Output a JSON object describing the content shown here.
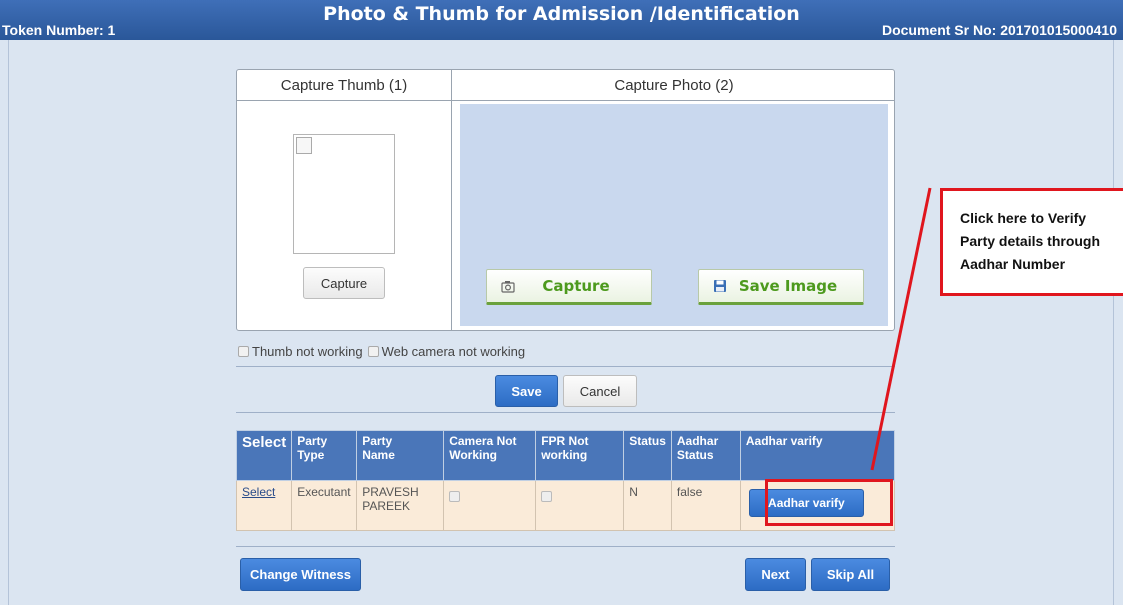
{
  "header": {
    "title": "Photo & Thumb for Admission /Identification",
    "token_label": "Token Number: 1",
    "document_label": "Document Sr No: 201701015000410"
  },
  "capture": {
    "thumb_title": "Capture Thumb (1)",
    "photo_title": "Capture Photo (2)",
    "thumb_capture_label": "Capture",
    "photo_capture_label": "Capture",
    "save_image_label": "Save Image"
  },
  "options": {
    "thumb_not_working": "Thumb not working",
    "web_camera_not_working": "Web camera not working"
  },
  "actions": {
    "save_label": "Save",
    "cancel_label": "Cancel",
    "change_witness_label": "Change Witness",
    "next_label": "Next",
    "skip_all_label": "Skip All"
  },
  "table": {
    "headers": {
      "select": "Select",
      "party_type_1": "Party",
      "party_type_2": "Type",
      "party_name_1": "Party",
      "party_name_2": "Name",
      "camera_1": "Camera Not",
      "camera_2": "Working",
      "fpr_1": "FPR Not",
      "fpr_2": "working",
      "status": "Status",
      "aadhar_status_1": "Aadhar",
      "aadhar_status_2": "Status",
      "aadhar_verify": "Aadhar varify"
    },
    "rows": [
      {
        "select": "Select",
        "party_type": "Executant",
        "party_name_1": "PRAVESH",
        "party_name_2": "PAREEK",
        "camera_not_working": false,
        "fpr_not_working": false,
        "status": "N",
        "aadhar_status": "false",
        "aadhar_verify_label": "Aadhar varify"
      }
    ]
  },
  "callout": {
    "line1": "Click here to Verify",
    "line2": "Party details through",
    "line3": "Aadhar Number"
  },
  "colors": {
    "header_bar": "#2f5fa6",
    "page_bg": "#dbe5f1",
    "button_blue": "#3574cc",
    "table_header": "#4a76b9",
    "table_row": "#faebd9",
    "highlight_red": "#e0161e",
    "green_label": "#4d9a1e"
  },
  "icons": [
    "camera-icon",
    "floppy-disk-icon",
    "broken-image-icon",
    "callout-arrow"
  ]
}
